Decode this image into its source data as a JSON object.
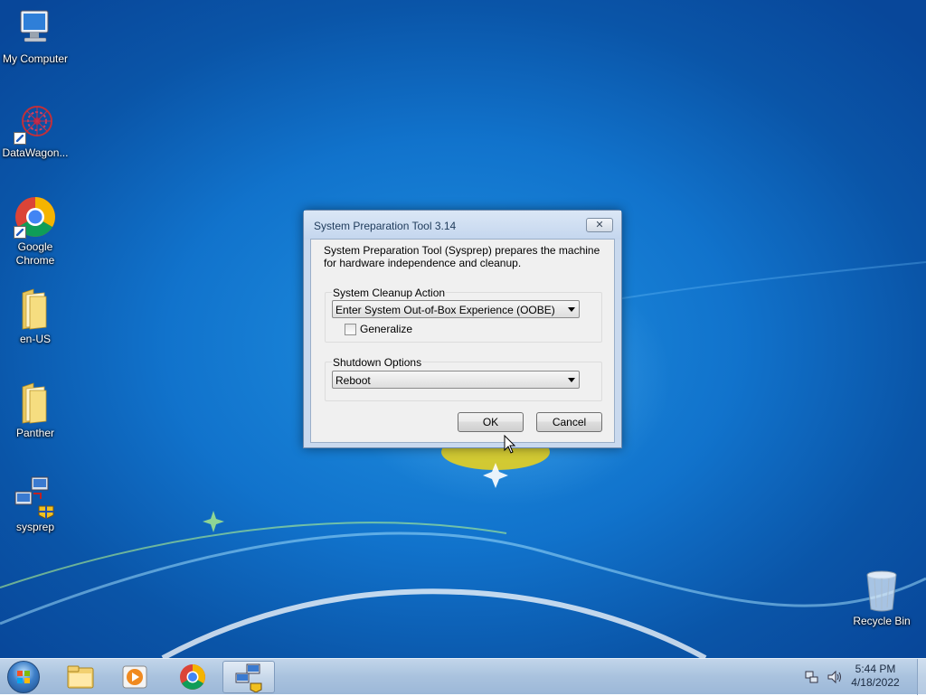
{
  "desktop": {
    "icons": [
      {
        "label": "My Computer",
        "icon": "computer-icon"
      },
      {
        "label": "DataWagon...",
        "icon": "datawagon-icon"
      },
      {
        "label": "Google\nChrome",
        "icon": "chrome-icon"
      },
      {
        "label": "en-US",
        "icon": "folder-icon"
      },
      {
        "label": "Panther",
        "icon": "folder-icon"
      },
      {
        "label": "sysprep",
        "icon": "sysprep-icon"
      },
      {
        "label": "Recycle Bin",
        "icon": "recycle-bin-icon"
      }
    ]
  },
  "dialog": {
    "title": "System Preparation Tool 3.14",
    "close_glyph": "✕",
    "description": "System Preparation Tool (Sysprep) prepares the machine for hardware independence and cleanup.",
    "cleanup_group_label": "System Cleanup Action",
    "cleanup_action_value": "Enter System Out-of-Box Experience (OOBE)",
    "generalize_label": "Generalize",
    "generalize_checked": false,
    "shutdown_group_label": "Shutdown Options",
    "shutdown_value": "Reboot",
    "ok_label": "OK",
    "cancel_label": "Cancel"
  },
  "taskbar": {
    "pinned": [
      "start-orb",
      "explorer-icon",
      "media-player-icon",
      "chrome-icon",
      "sysprep-icon"
    ],
    "active": "sysprep-icon",
    "clock_time": "5:44 PM",
    "clock_date": "4/18/2022"
  },
  "colors": {
    "desktop_blue": "#1173cc",
    "dialog_frame": "#c9d9ee",
    "taskbar": "#a9c2de"
  }
}
